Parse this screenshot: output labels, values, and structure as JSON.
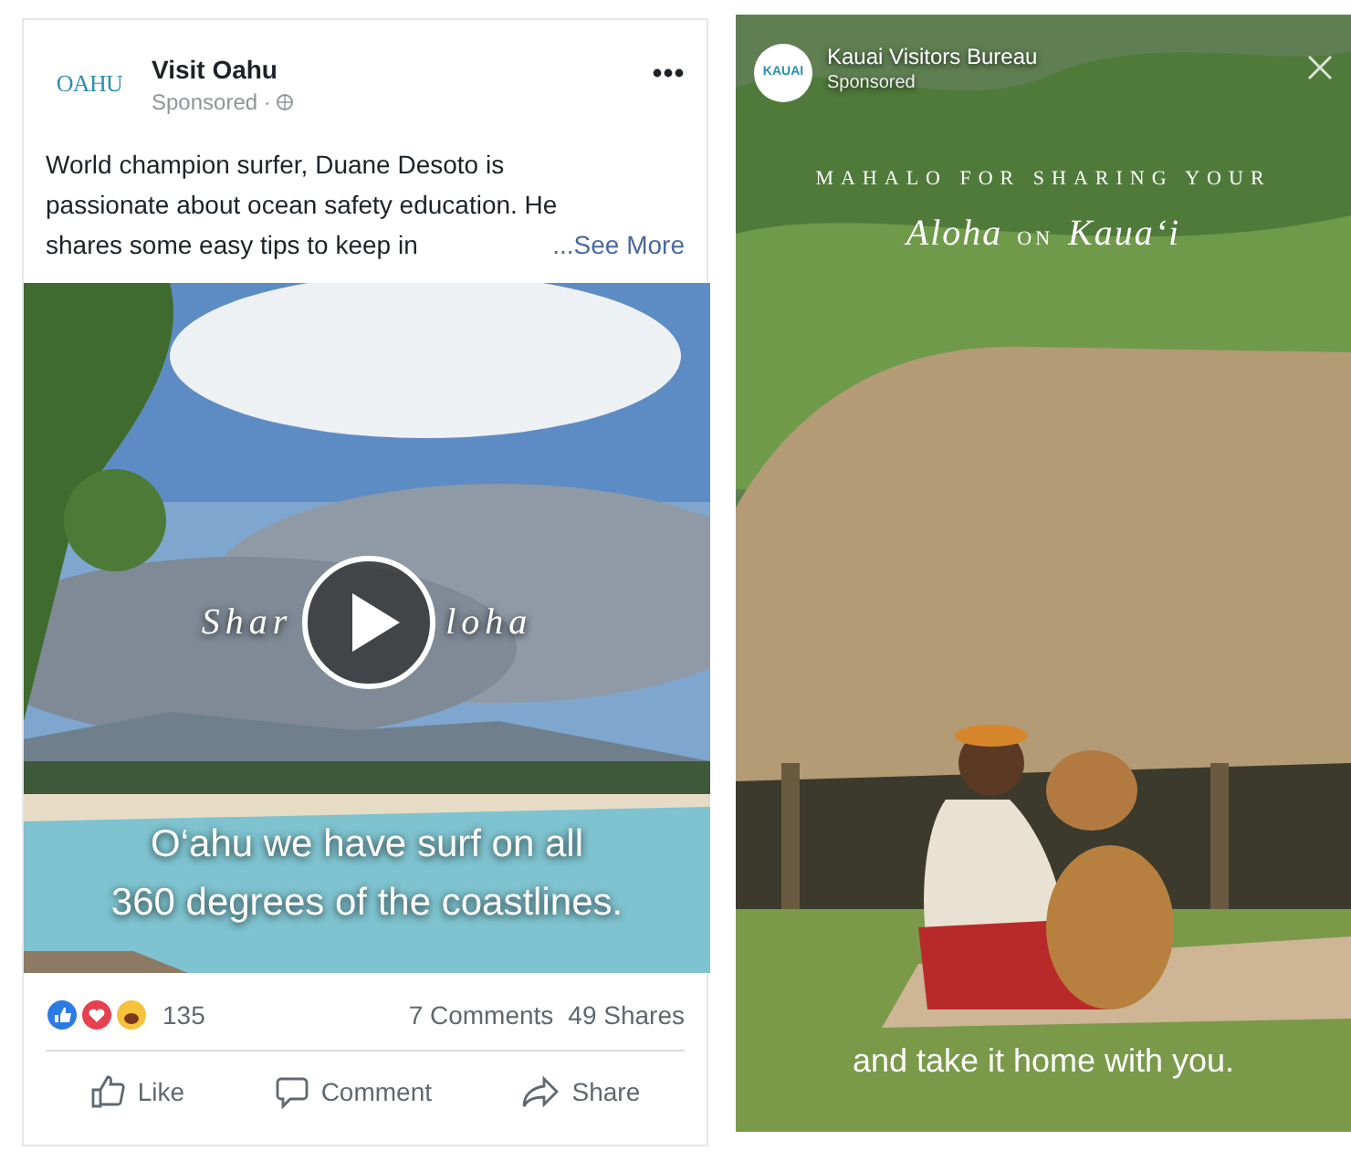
{
  "left_post": {
    "page_logo": "OAHU",
    "page_name": "Visit Oahu",
    "subtitle": "Sponsored ·",
    "caption_lines": [
      "World champion surfer, Duane Desoto is",
      "passionate about ocean safety education. He",
      "shares some easy tips to keep in"
    ],
    "see_more": "...See More",
    "video": {
      "overlay_title_parts": [
        "Shar",
        "loha"
      ],
      "subtitles": [
        "O‘ahu we have surf on all",
        "360 degrees of the coastlines."
      ]
    },
    "reaction_count": "135",
    "comments": "7 Comments",
    "shares": "49 Shares",
    "actions": [
      {
        "kind": "like",
        "label": "Like"
      },
      {
        "kind": "comment",
        "label": "Comment"
      },
      {
        "kind": "share",
        "label": "Share"
      }
    ]
  },
  "right_post": {
    "page_logo": "KAUAI",
    "page_name": "Kauai Visitors Bureau",
    "subtitle": "Sponsored",
    "headline": "MAHALO FOR SHARING YOUR",
    "tagline_parts": [
      "Aloha",
      "ON",
      "Kaua‘i"
    ],
    "caption": "and take it home with you."
  }
}
